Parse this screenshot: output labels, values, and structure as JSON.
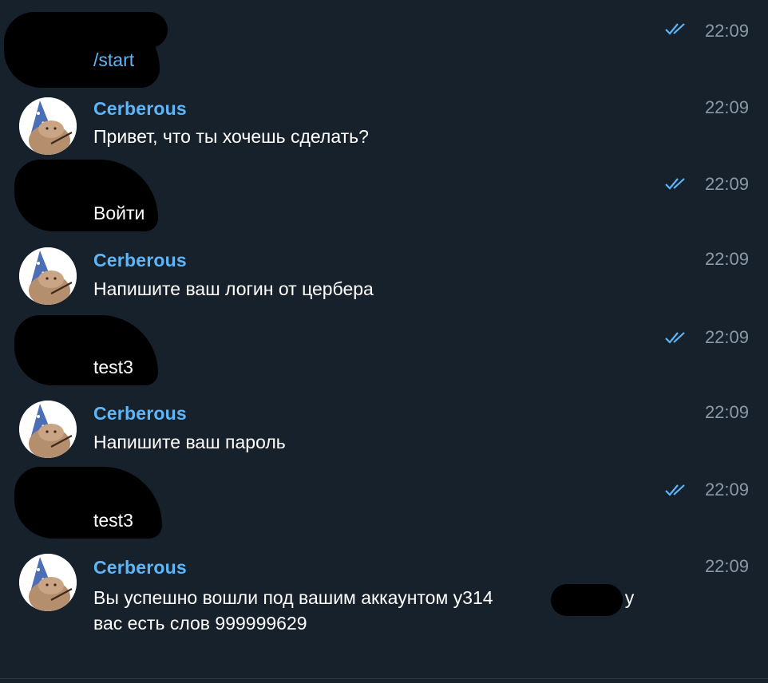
{
  "colors": {
    "background": "#17212b",
    "sender_name": "#5eb5f7",
    "command_link": "#5eb5f7",
    "message_text": "#ffffff",
    "timestamp": "#8b9aa8",
    "read_checks": "#5eb5f7"
  },
  "messages": [
    {
      "kind": "outgoing",
      "text": "/start",
      "time": "22:09",
      "read_icon": "double-check-icon"
    },
    {
      "kind": "incoming",
      "sender": "Cerberous",
      "text": "Привет, что ты хочешь сделать?",
      "time": "22:09"
    },
    {
      "kind": "outgoing",
      "text": "Войти",
      "time": "22:09",
      "read_icon": "double-check-icon"
    },
    {
      "kind": "incoming",
      "sender": "Cerberous",
      "text": "Напишите ваш логин от цербера",
      "time": "22:09"
    },
    {
      "kind": "outgoing",
      "text": "test3",
      "time": "22:09",
      "read_icon": "double-check-icon"
    },
    {
      "kind": "incoming",
      "sender": "Cerberous",
      "text": "Напишите ваш пароль",
      "time": "22:09"
    },
    {
      "kind": "outgoing",
      "text": "test3",
      "time": "22:09",
      "read_icon": "double-check-icon"
    },
    {
      "kind": "incoming",
      "sender": "Cerberous",
      "text_line1": "Вы успешно вошли под вашим аккаунтом у314",
      "text_line1_tail": ", у",
      "text_line2": "вас есть слов 999999629",
      "time": "22:09"
    }
  ]
}
